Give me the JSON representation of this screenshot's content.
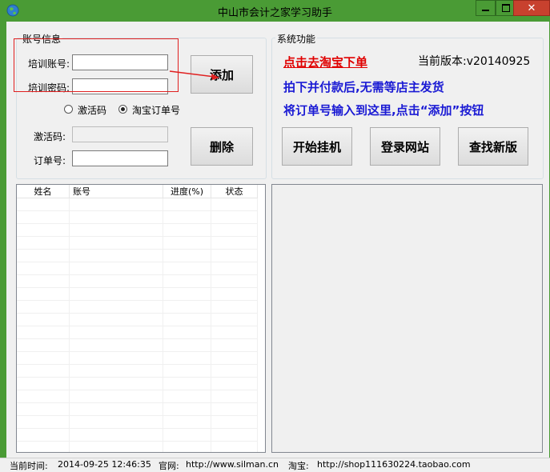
{
  "window": {
    "title": "中山市会计之家学习助手",
    "icon": "globe-icon",
    "controls": {
      "minimize": "minimize-icon",
      "maximize": "maximize-icon",
      "close": "close-icon"
    }
  },
  "account_group": {
    "label": "账号信息",
    "username_label": "培训账号:",
    "username_value": "",
    "password_label": "培训密码:",
    "password_value": "",
    "add_button": "添加",
    "radio_activation": "激活码",
    "radio_taobao": "淘宝订单号",
    "selected_radio": "淘宝订单号",
    "activation_label": "激活码:",
    "activation_value": "",
    "order_label": "订单号:",
    "order_value": "",
    "delete_button": "删除"
  },
  "system_group": {
    "label": "系统功能",
    "taobao_link": "点击去淘宝下单",
    "version": "当前版本:v20140925",
    "instruction_1": "拍下并付款后,无需等店主发货",
    "instruction_2": "将订单号输入到这里,点击“添加”按钮",
    "start_button": "开始挂机",
    "login_button": "登录网站",
    "update_button": "查找新版"
  },
  "table": {
    "columns": [
      "姓名",
      "账号",
      "进度(%)",
      "状态"
    ],
    "rows": []
  },
  "status_bar": {
    "time_label": "当前时间:",
    "time_value": "2014-09-25 12:46:35",
    "site_label": "官网:",
    "site_value": "http://www.silman.cn",
    "shop_label": "淘宝:",
    "shop_value": "http://shop111630224.taobao.com"
  },
  "colors": {
    "titlebar": "#4a9b35",
    "close_button": "#c8412e",
    "link_red": "#e00000",
    "instruction_blue": "#1a1ad4",
    "annotation_red": "#e02020"
  }
}
